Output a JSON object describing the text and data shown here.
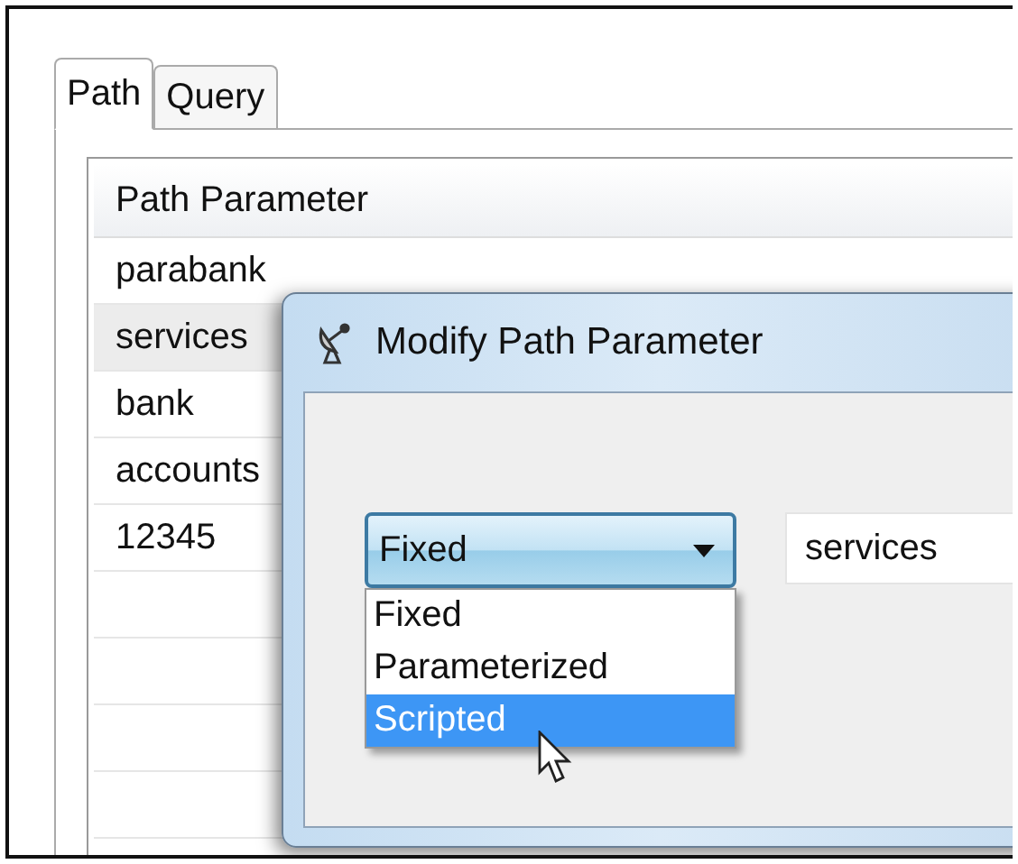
{
  "tabs": [
    {
      "label": "Path",
      "selected": true
    },
    {
      "label": "Query",
      "selected": false
    }
  ],
  "table": {
    "column": "Path Parameter",
    "rows": [
      {
        "value": "parabank",
        "selected": false
      },
      {
        "value": "services",
        "selected": true
      },
      {
        "value": "bank",
        "selected": false
      },
      {
        "value": "accounts",
        "selected": false
      },
      {
        "value": "12345",
        "selected": false
      }
    ]
  },
  "dialog": {
    "title": "Modify Path Parameter",
    "type_select": {
      "value": "Fixed",
      "expanded": true,
      "options": [
        {
          "label": "Fixed",
          "highlighted": false
        },
        {
          "label": "Parameterized",
          "highlighted": false
        },
        {
          "label": "Scripted",
          "highlighted": true
        }
      ]
    },
    "value_field": {
      "value": "services"
    }
  }
}
